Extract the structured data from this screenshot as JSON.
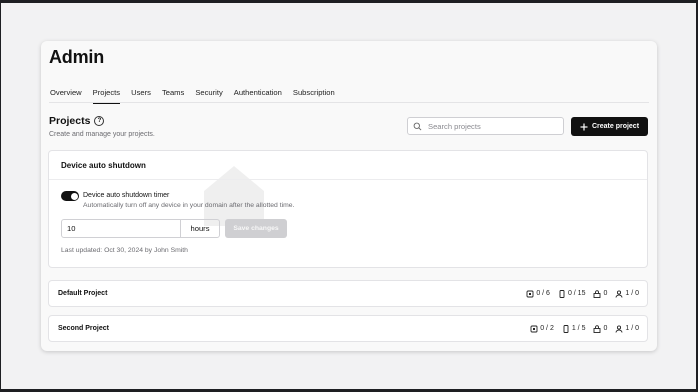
{
  "page": {
    "title": "Admin"
  },
  "tabs": [
    {
      "label": "Overview",
      "active": false
    },
    {
      "label": "Projects",
      "active": true
    },
    {
      "label": "Users",
      "active": false
    },
    {
      "label": "Teams",
      "active": false
    },
    {
      "label": "Security",
      "active": false
    },
    {
      "label": "Authentication",
      "active": false
    },
    {
      "label": "Subscription",
      "active": false
    }
  ],
  "projects_header": {
    "title": "Projects",
    "subtitle": "Create and manage your projects.",
    "help_icon": "question-circle-icon"
  },
  "search": {
    "placeholder": "Search projects",
    "value": "",
    "icon": "search-icon"
  },
  "create_button": {
    "label": "Create project",
    "icon": "plus-icon"
  },
  "auto_shutdown": {
    "title": "Device auto shutdown",
    "toggle": {
      "label": "Device auto shutdown timer",
      "description": "Automatically turn off any device in your domain after the allotted time.",
      "enabled": true
    },
    "duration_value": "10",
    "unit": "hours",
    "save_label": "Save changes",
    "save_disabled": true,
    "last_updated": "Last updated: Oct 30, 2024 by John Smith"
  },
  "project_rows": [
    {
      "name": "Default Project",
      "stats": [
        {
          "icon": "chip-icon",
          "value": "0 / 6"
        },
        {
          "icon": "phone-icon",
          "value": "0 / 15"
        },
        {
          "icon": "lock-icon",
          "value": "0"
        },
        {
          "icon": "user-icon",
          "value": "1 / 0"
        }
      ]
    },
    {
      "name": "Second Project",
      "stats": [
        {
          "icon": "chip-icon",
          "value": "0 / 2"
        },
        {
          "icon": "phone-icon",
          "value": "1 / 5"
        },
        {
          "icon": "lock-icon",
          "value": "0"
        },
        {
          "icon": "user-icon",
          "value": "1 / 0"
        }
      ]
    }
  ],
  "colors": {
    "accent": "#111111",
    "disabled_button": "#cfcfd2",
    "muted_text": "#6b6b70"
  }
}
